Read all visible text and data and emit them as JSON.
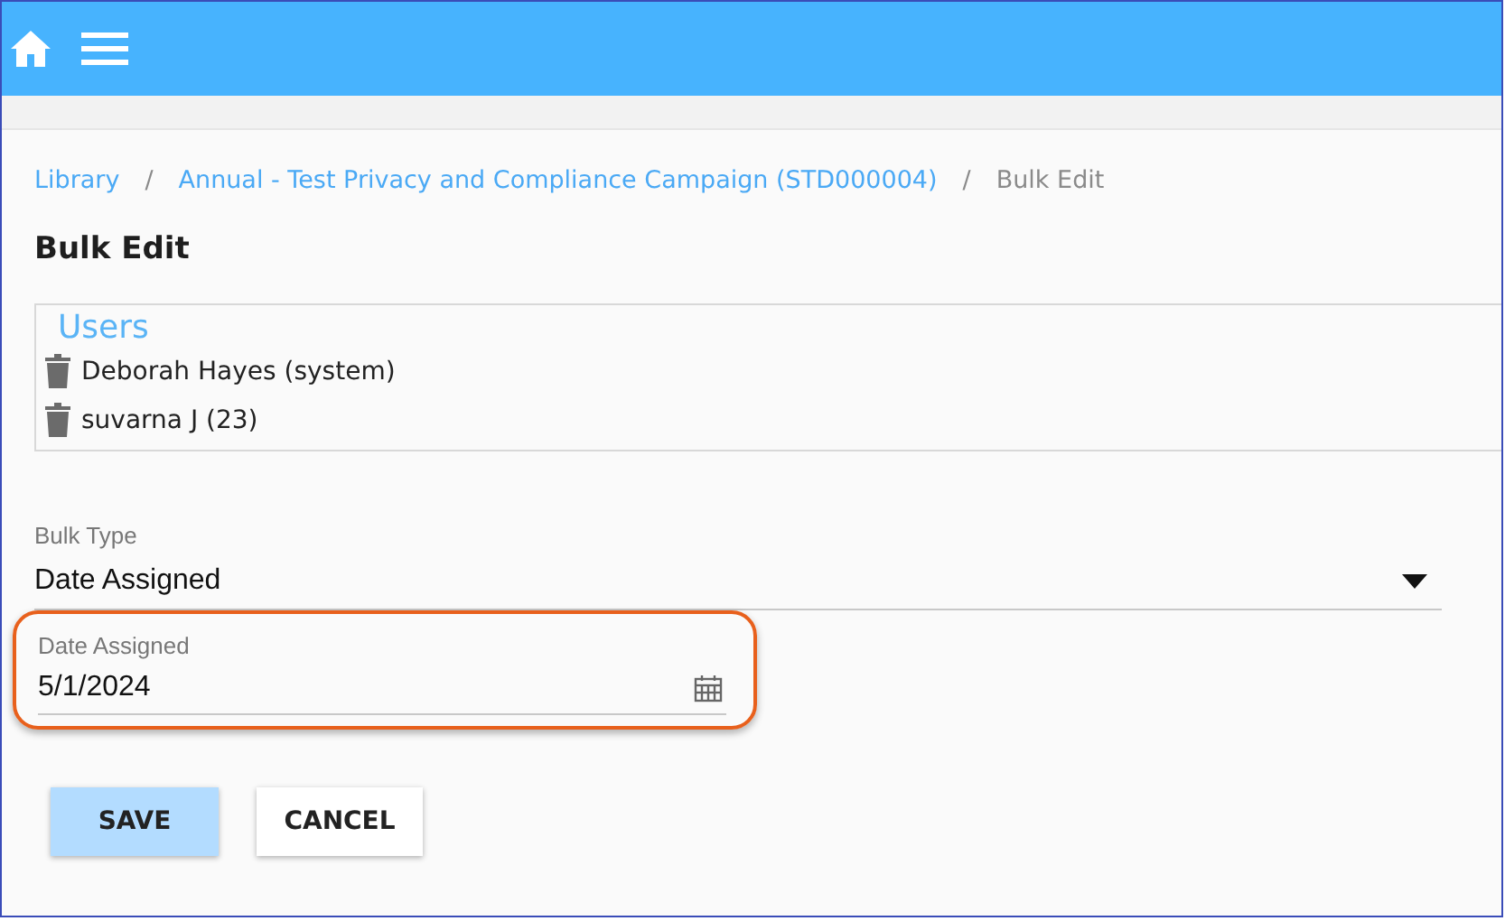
{
  "breadcrumb": [
    {
      "label": "Library",
      "kind": "link"
    },
    {
      "label": "/",
      "kind": "separator"
    },
    {
      "label": "Annual - Test Privacy and Compliance Campaign (STD000004)",
      "kind": "link"
    },
    {
      "label": "/",
      "kind": "separator"
    },
    {
      "label": "Bulk Edit",
      "kind": "current"
    }
  ],
  "page_title": "Bulk Edit",
  "users": {
    "heading": "Users",
    "items": [
      {
        "label": "Deborah Hayes (system)"
      },
      {
        "label": "suvarna J (23)"
      }
    ]
  },
  "bulk_type": {
    "label": "Bulk Type",
    "value": "Date Assigned"
  },
  "date_field": {
    "label": "Date Assigned",
    "value": "5/1/2024",
    "highlighted": true
  },
  "buttons": [
    {
      "label": "SAVE",
      "kind": "primary"
    },
    {
      "label": "CANCEL",
      "kind": "secondary"
    }
  ]
}
